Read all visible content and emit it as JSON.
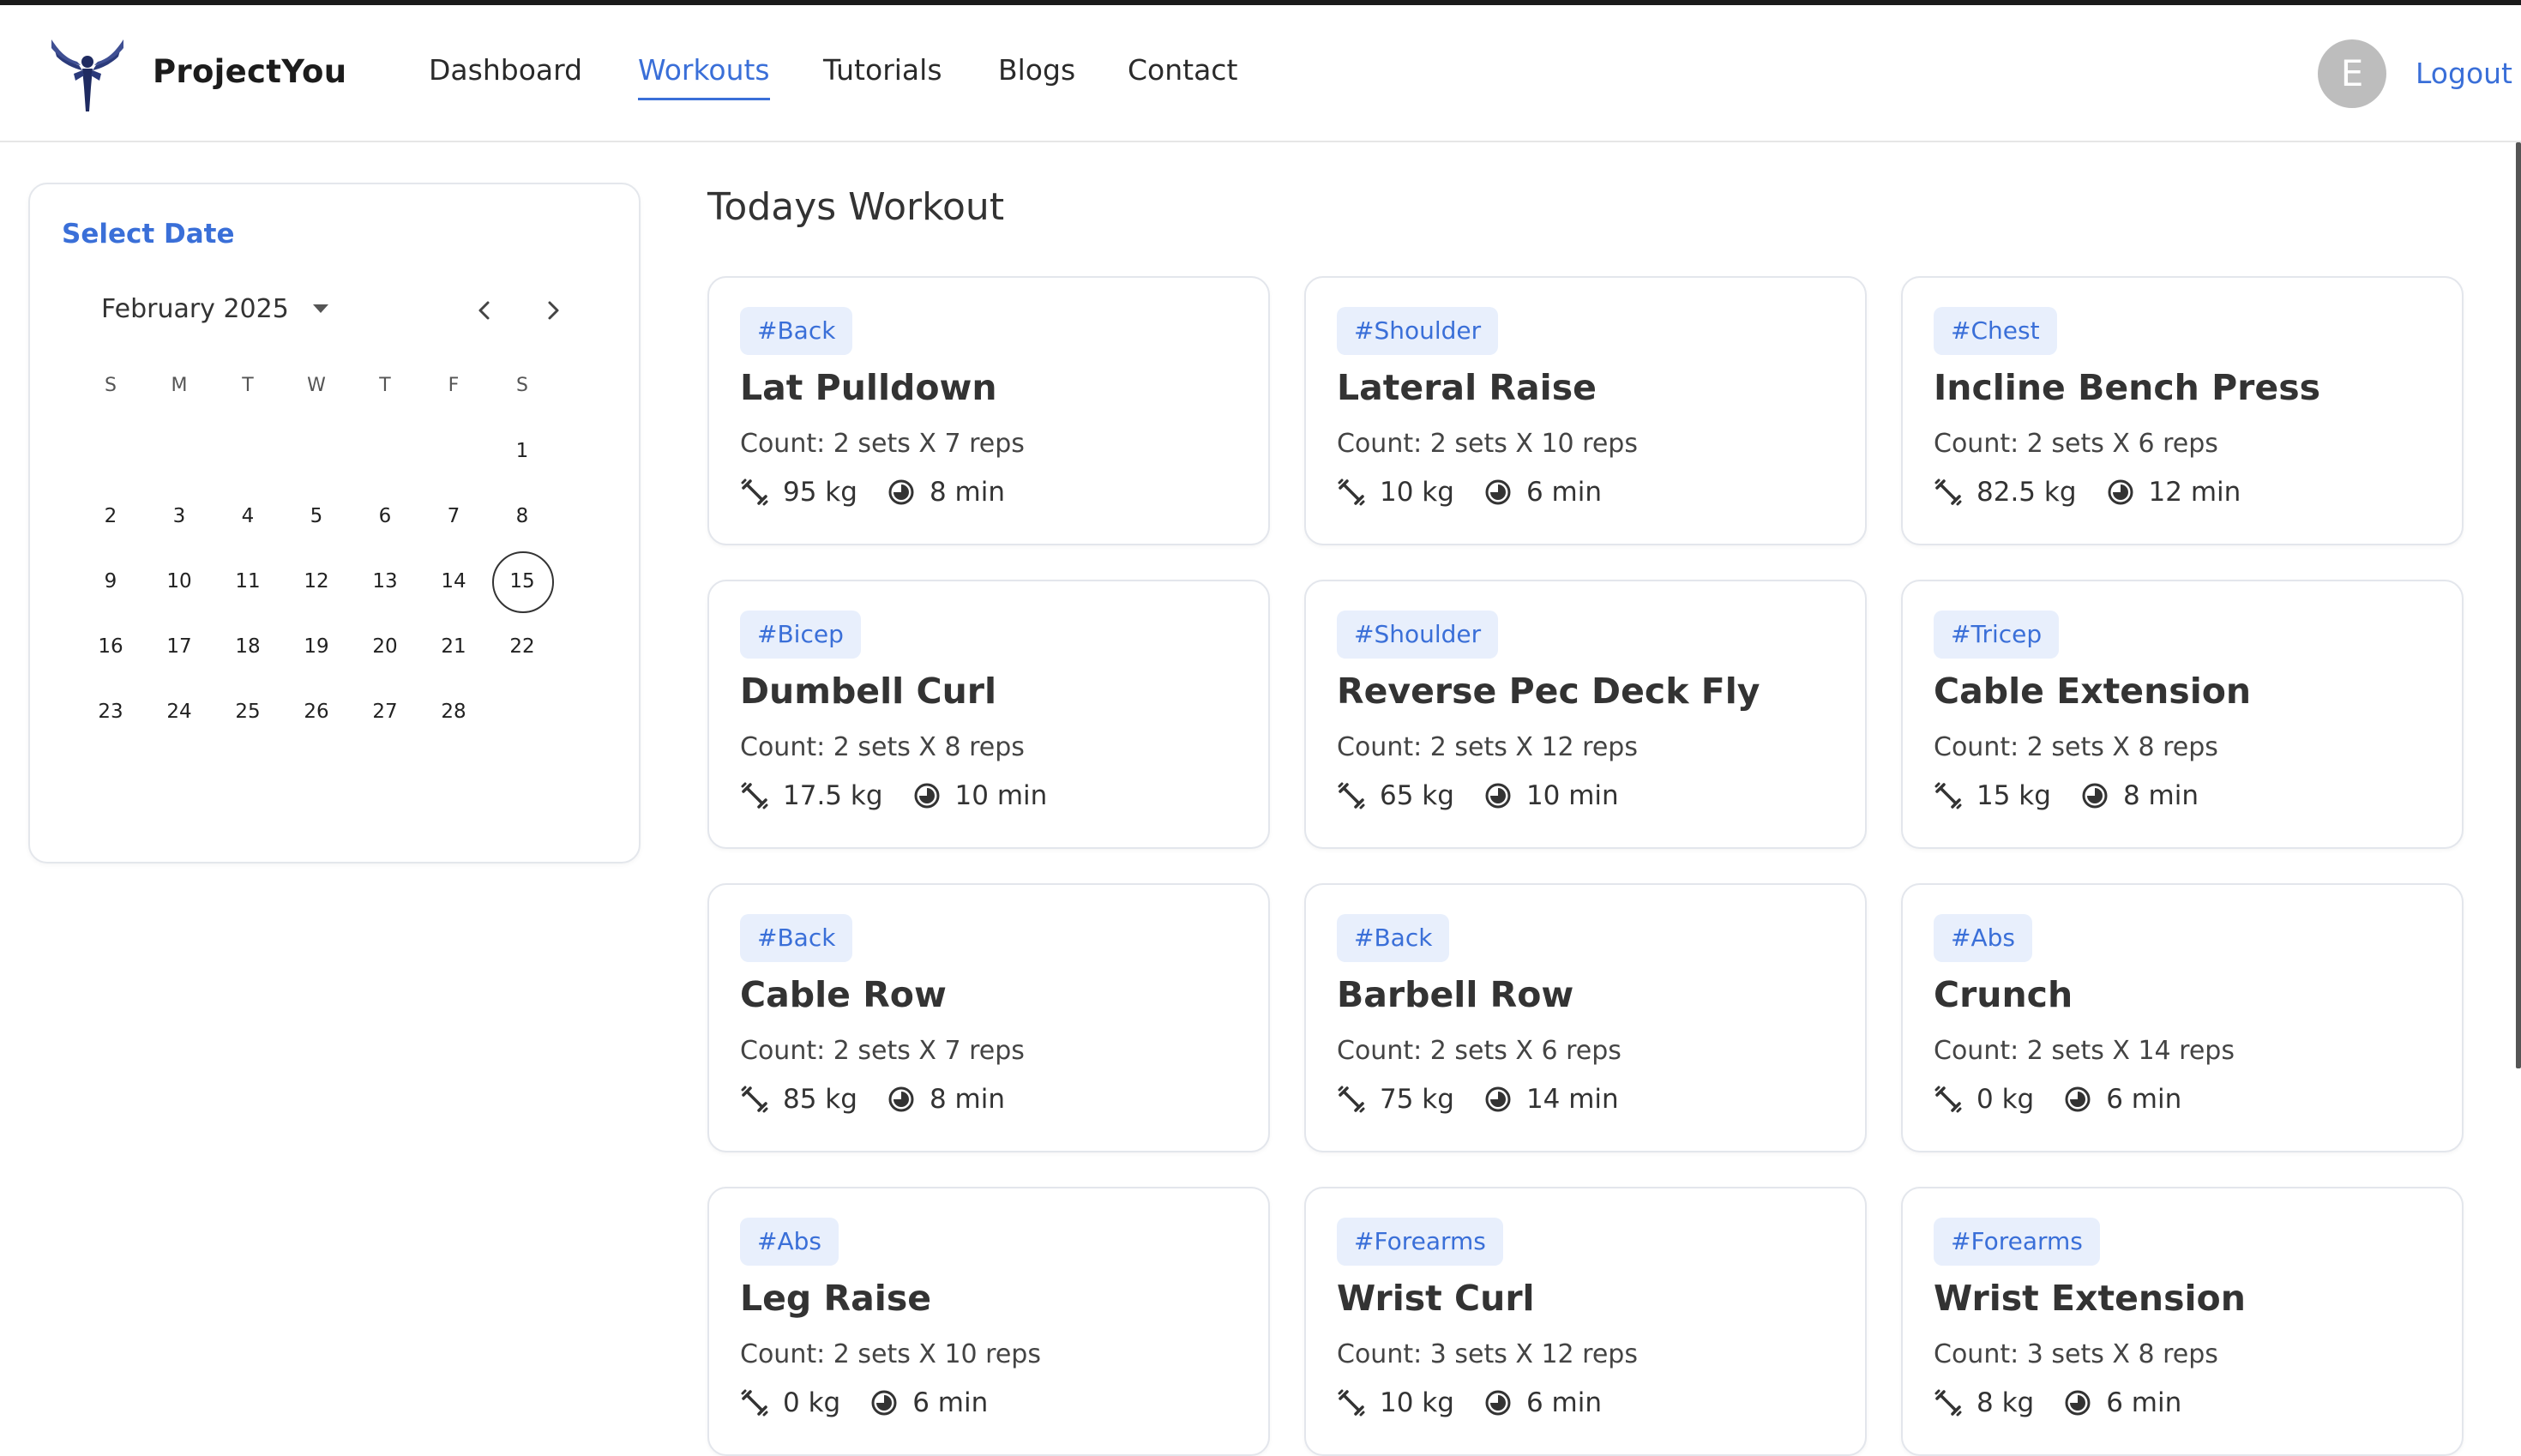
{
  "header": {
    "brand": "ProjectYou",
    "nav": [
      "Dashboard",
      "Workouts",
      "Tutorials",
      "Blogs",
      "Contact"
    ],
    "active_nav": "Workouts",
    "avatar_initial": "E",
    "logout": "Logout"
  },
  "calendar": {
    "title": "Select Date",
    "month_label": "February 2025",
    "weekdays": [
      "S",
      "M",
      "T",
      "W",
      "T",
      "F",
      "S"
    ],
    "first_weekday_index": 6,
    "days_in_month": 28,
    "selected_day": 15
  },
  "main": {
    "title": "Todays Workout",
    "cards": [
      {
        "tag": "#Back",
        "name": "Lat Pulldown",
        "count": "Count: 2 sets X 7 reps",
        "weight": "95 kg",
        "time": "8 min"
      },
      {
        "tag": "#Shoulder",
        "name": "Lateral Raise",
        "count": "Count: 2 sets X 10 reps",
        "weight": "10 kg",
        "time": "6 min"
      },
      {
        "tag": "#Chest",
        "name": "Incline Bench Press",
        "count": "Count: 2 sets X 6 reps",
        "weight": "82.5 kg",
        "time": "12 min"
      },
      {
        "tag": "#Bicep",
        "name": "Dumbell Curl",
        "count": "Count: 2 sets X 8 reps",
        "weight": "17.5 kg",
        "time": "10 min"
      },
      {
        "tag": "#Shoulder",
        "name": "Reverse Pec Deck Fly",
        "count": "Count: 2 sets X 12 reps",
        "weight": "65 kg",
        "time": "10 min"
      },
      {
        "tag": "#Tricep",
        "name": "Cable Extension",
        "count": "Count: 2 sets X 8 reps",
        "weight": "15 kg",
        "time": "8 min"
      },
      {
        "tag": "#Back",
        "name": "Cable Row",
        "count": "Count: 2 sets X 7 reps",
        "weight": "85 kg",
        "time": "8 min"
      },
      {
        "tag": "#Back",
        "name": "Barbell Row",
        "count": "Count: 2 sets X 6 reps",
        "weight": "75 kg",
        "time": "14 min"
      },
      {
        "tag": "#Abs",
        "name": "Crunch",
        "count": "Count: 2 sets X 14 reps",
        "weight": "0 kg",
        "time": "6 min"
      },
      {
        "tag": "#Abs",
        "name": "Leg Raise",
        "count": "Count: 2 sets X 10 reps",
        "weight": "0 kg",
        "time": "6 min"
      },
      {
        "tag": "#Forearms",
        "name": "Wrist Curl",
        "count": "Count: 3 sets X 12 reps",
        "weight": "10 kg",
        "time": "6 min"
      },
      {
        "tag": "#Forearms",
        "name": "Wrist Extension",
        "count": "Count: 3 sets X 8 reps",
        "weight": "8 kg",
        "time": "6 min"
      }
    ]
  },
  "icons": {
    "weight": "dumbbell-icon",
    "time": "timer-icon",
    "logo": "winged-figure-logo-icon"
  },
  "colors": {
    "accent": "#3a6fd8",
    "tag_bg": "#e8effc"
  }
}
